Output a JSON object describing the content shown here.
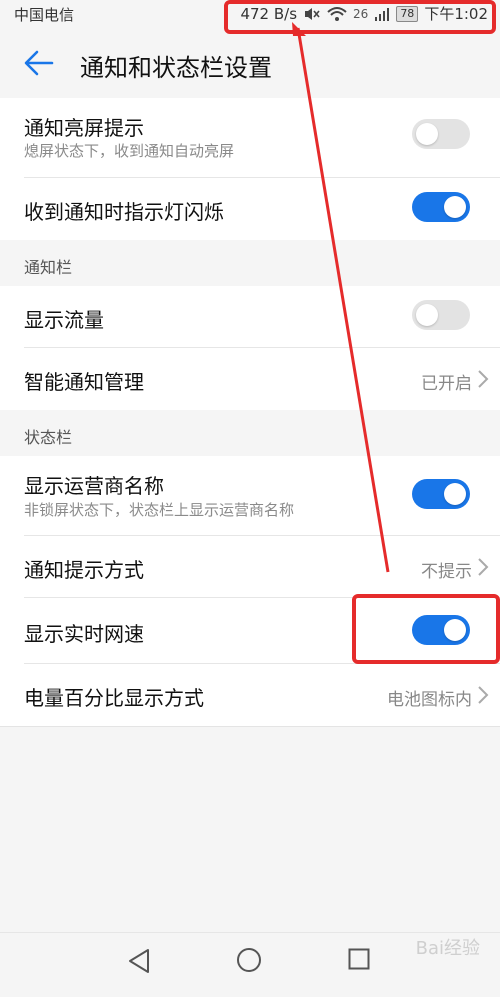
{
  "statusbar": {
    "carrier": "中国电信",
    "net_speed": "472 B/s",
    "network_type": "26",
    "battery": "78",
    "time": "下午1:02",
    "icons": [
      "mute-icon",
      "wifi-icon",
      "signal-icon",
      "battery-icon"
    ]
  },
  "header": {
    "title": "通知和状态栏设置"
  },
  "items": {
    "notify_wake": {
      "label": "通知亮屏提示",
      "sub": "熄屏状态下，收到通知自动亮屏",
      "toggle": "off"
    },
    "led_blink": {
      "label": "收到通知时指示灯闪烁",
      "toggle": "on"
    }
  },
  "sections": {
    "notify_bar": "通知栏",
    "status_bar": "状态栏"
  },
  "notify_bar_items": {
    "show_traffic": {
      "label": "显示流量",
      "toggle": "off"
    },
    "smart_notify": {
      "label": "智能通知管理",
      "value": "已开启"
    }
  },
  "status_bar_items": {
    "show_carrier": {
      "label": "显示运营商名称",
      "sub": "非锁屏状态下，状态栏上显示运营商名称",
      "toggle": "on"
    },
    "notify_method": {
      "label": "通知提示方式",
      "value": "不提示"
    },
    "realtime_speed": {
      "label": "显示实时网速",
      "toggle": "on"
    },
    "battery_percent": {
      "label": "电量百分比显示方式",
      "value": "电池图标内"
    }
  },
  "navbar": {
    "icons": [
      "back-triangle-icon",
      "home-circle-icon",
      "recent-square-icon"
    ]
  },
  "watermark": "Bai经验",
  "colors": {
    "accent": "#1976e8",
    "annotation": "#e52b2b",
    "toggle_off": "#e3e3e3"
  }
}
